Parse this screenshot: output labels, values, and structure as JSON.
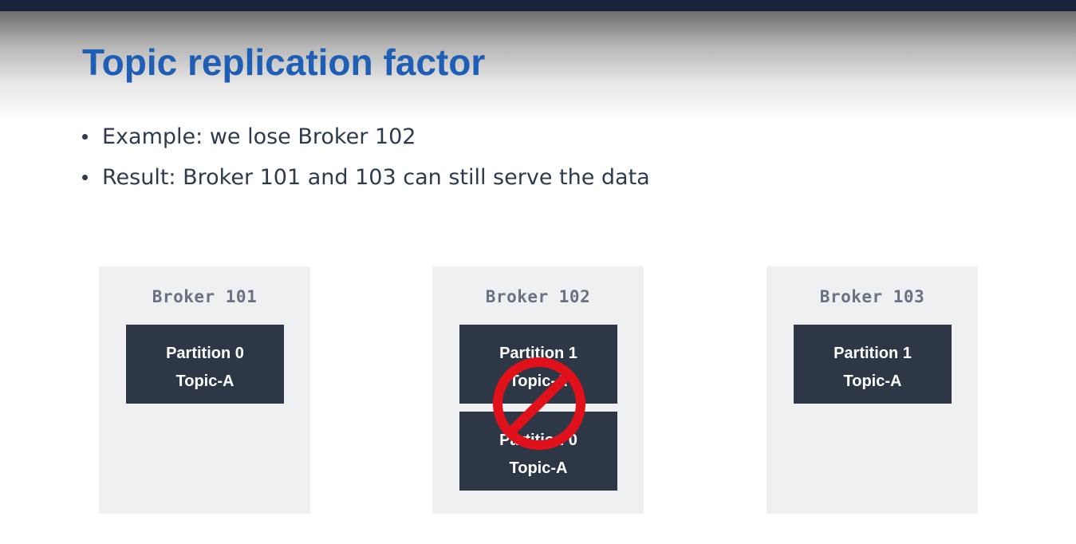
{
  "slide": {
    "title": "Topic replication factor",
    "bullets": [
      "Example: we lose Broker 102",
      "Result: Broker 101 and 103 can still serve the data"
    ]
  },
  "brokers": [
    {
      "label": "Broker 101",
      "partitions": [
        {
          "name": "Partition 0",
          "topic": "Topic-A"
        }
      ]
    },
    {
      "label": "Broker 102",
      "status_icon": "prohibited-icon",
      "partitions": [
        {
          "name": "Partition 1",
          "topic": "Topic-A"
        },
        {
          "name": "Partition 0",
          "topic": "Topic-A"
        }
      ]
    },
    {
      "label": "Broker 103",
      "partitions": [
        {
          "name": "Partition 1",
          "topic": "Topic-A"
        }
      ]
    }
  ],
  "colors": {
    "title": "#1e5fb5",
    "partition_bg": "#2e3746",
    "broker_bg": "#eff0f2",
    "broker_label": "#6a7282",
    "prohibited": "#e0111b"
  }
}
